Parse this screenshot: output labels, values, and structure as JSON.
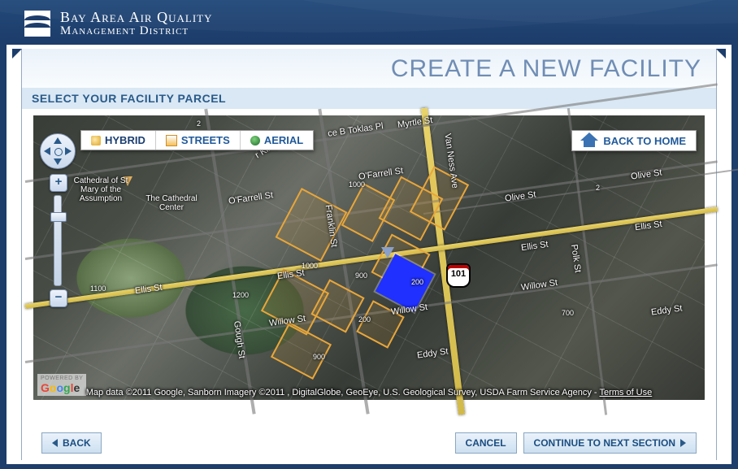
{
  "org": {
    "line1": "Bay Area Air Quality",
    "line2": "Management District"
  },
  "page_title": "CREATE A NEW FACILITY",
  "section_heading": "SELECT YOUR FACILITY PARCEL",
  "map": {
    "layer_buttons": {
      "hybrid": "HYBRID",
      "streets": "STREETS",
      "aerial": "AERIAL"
    },
    "active_layer": "HYBRID",
    "back_home": "BACK TO HOME",
    "zoom": {
      "plus": "+",
      "minus": "−",
      "level_percent": 18
    },
    "streets": [
      "O'Farrell St",
      "Ellis St",
      "Willow St",
      "Eddy St",
      "Olive St",
      "Myrtle St",
      "ce B Toklas Pl",
      "Gough St",
      "Franklin St",
      "Van Ness Ave",
      "Polk St",
      "r King Way"
    ],
    "poi": [
      "Cathedral of St Mary of the Assumption",
      "The Cathedral Center"
    ],
    "highway_shield": "101",
    "address_nums": [
      "1000",
      "1100",
      "1200",
      "900",
      "200",
      "700",
      "2"
    ],
    "attribution": "Map data ©2011 Google, Sanborn  Imagery ©2011 , DigitalGlobe, GeoEye, U.S. Geological Survey, USDA Farm Service Agency - ",
    "terms_link": "Terms of Use",
    "google": "Google",
    "powered_by": "POWERED BY"
  },
  "footer": {
    "back": "BACK",
    "cancel": "CANCEL",
    "continue": "CONTINUE TO NEXT SECTION"
  }
}
